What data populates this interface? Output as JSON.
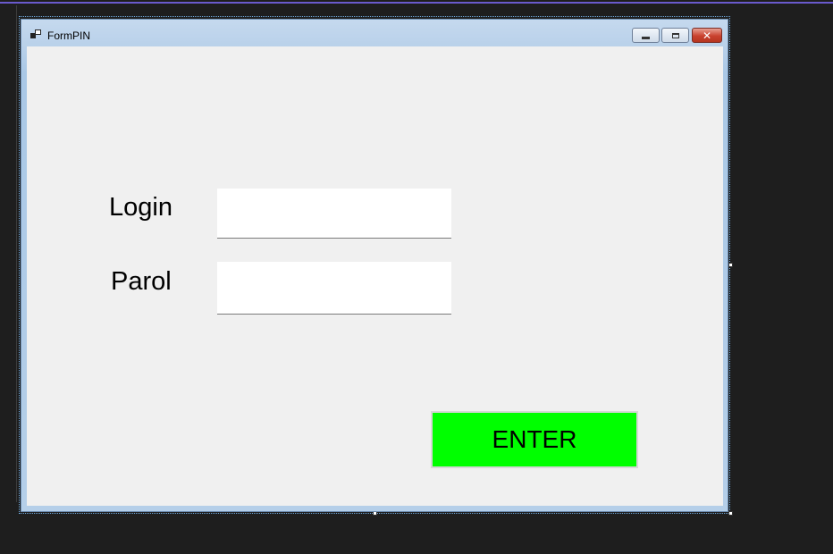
{
  "window": {
    "title": "FormPIN",
    "app_icon": "form-icon",
    "controls": {
      "minimize": "minimize-icon",
      "maximize": "maximize-icon",
      "close": "close-icon",
      "close_glyph": "✕"
    }
  },
  "form": {
    "login_label": "Login",
    "login_value": "",
    "parol_label": "Parol",
    "parol_value": "",
    "enter_label": "ENTER",
    "enter_color": "#00ff00"
  },
  "colors": {
    "editor_background": "#1e1e1e",
    "form_background": "#f0f0f0",
    "accent": "#6a5acd"
  }
}
